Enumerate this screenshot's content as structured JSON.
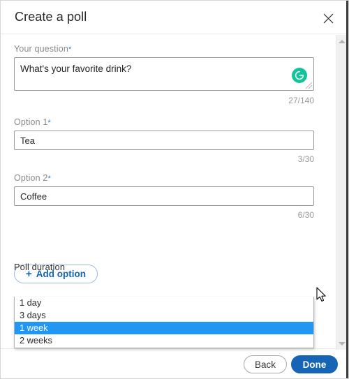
{
  "header": {
    "title": "Create a poll",
    "close_icon": "close-icon"
  },
  "form": {
    "question": {
      "label": "Your question",
      "required_marker": "*",
      "value": "What's your favorite drink?",
      "counter": "27/140",
      "assistant_icon": "grammarly-icon",
      "assistant_letter": "G"
    },
    "option1": {
      "label": "Option 1",
      "required_marker": "*",
      "value": "Tea",
      "placeholder": "",
      "counter": "3/30"
    },
    "option2": {
      "label": "Option 2",
      "required_marker": "*",
      "value": "Coffee",
      "placeholder": "",
      "counter": "6/30"
    },
    "add_option": {
      "plus": "+",
      "label": "Add option"
    },
    "duration": {
      "label": "Poll duration",
      "selected": "1 week",
      "options": [
        {
          "label": "1 day",
          "selected": false
        },
        {
          "label": "3 days",
          "selected": false
        },
        {
          "label": "1 week",
          "selected": true
        },
        {
          "label": "2 weeks",
          "selected": false
        }
      ]
    }
  },
  "footer": {
    "back_label": "Back",
    "done_label": "Done"
  },
  "colors": {
    "accent_blue": "#1564b5",
    "highlight_blue": "#2196f3",
    "grammarly_green": "#15c39a",
    "required_asterisk": "#2b7cd3"
  },
  "scrollbar": {
    "up_icon": "chevron-up-icon",
    "down_icon": "chevron-down-icon"
  }
}
